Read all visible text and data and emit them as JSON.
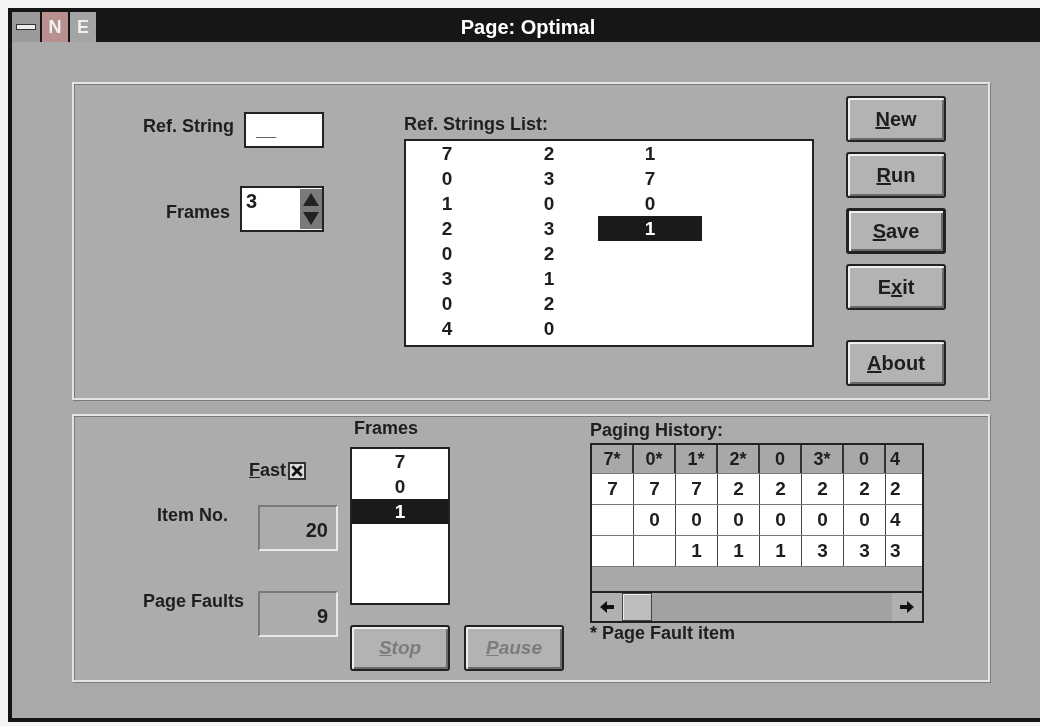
{
  "window": {
    "title": "Page: Optimal",
    "title_buttons": [
      "N",
      "E"
    ]
  },
  "ref_string": {
    "label": "Ref. String",
    "value": "__"
  },
  "frames_spin": {
    "label": "Frames",
    "value": "3"
  },
  "ref_list": {
    "label": "Ref. Strings List:",
    "columns": [
      [
        {
          "text": "7",
          "selected": false
        },
        {
          "text": "0",
          "selected": false
        },
        {
          "text": "1",
          "selected": false
        },
        {
          "text": "2",
          "selected": false
        },
        {
          "text": "0",
          "selected": false
        },
        {
          "text": "3",
          "selected": false
        },
        {
          "text": "0",
          "selected": false
        },
        {
          "text": "4",
          "selected": false
        }
      ],
      [
        {
          "text": "2",
          "selected": false
        },
        {
          "text": "3",
          "selected": false
        },
        {
          "text": "0",
          "selected": false
        },
        {
          "text": "3",
          "selected": false
        },
        {
          "text": "2",
          "selected": false
        },
        {
          "text": "1",
          "selected": false
        },
        {
          "text": "2",
          "selected": false
        },
        {
          "text": "0",
          "selected": false
        }
      ],
      [
        {
          "text": "1",
          "selected": false
        },
        {
          "text": "7",
          "selected": false
        },
        {
          "text": "0",
          "selected": false
        },
        {
          "text": "1",
          "selected": true
        }
      ]
    ]
  },
  "buttons": [
    {
      "key": "N",
      "rest": "ew",
      "default": false
    },
    {
      "key": "R",
      "rest": "un",
      "default": false
    },
    {
      "key": "S",
      "rest": "ave",
      "default": true
    },
    {
      "lead": "E",
      "key": "x",
      "rest": "it",
      "default": false
    },
    {
      "key": "A",
      "rest": "bout",
      "default": false
    }
  ],
  "fast": {
    "key": "F",
    "rest": "ast",
    "checked": true
  },
  "item_no": {
    "label": "Item No.",
    "value": "20"
  },
  "page_faults": {
    "label": "Page Faults",
    "value": "9"
  },
  "frames_list": {
    "label": "Frames",
    "items": [
      {
        "text": "7",
        "selected": false
      },
      {
        "text": "0",
        "selected": false
      },
      {
        "text": "1",
        "selected": true
      }
    ]
  },
  "run_buttons": [
    {
      "key": "S",
      "rest": "top",
      "disabled": true
    },
    {
      "key": "P",
      "rest": "ause",
      "disabled": true
    }
  ],
  "history": {
    "label": "Paging History:",
    "header": [
      "7*",
      "0*",
      "1*",
      "2*",
      "0",
      "3*",
      "0",
      "4"
    ],
    "rows": [
      [
        "7",
        "7",
        "7",
        "2",
        "2",
        "2",
        "2",
        "2"
      ],
      [
        null,
        "0",
        "0",
        "0",
        "0",
        "0",
        "0",
        "4"
      ],
      [
        null,
        null,
        "1",
        "1",
        "1",
        "3",
        "3",
        "3"
      ]
    ],
    "note": "* Page Fault item"
  }
}
